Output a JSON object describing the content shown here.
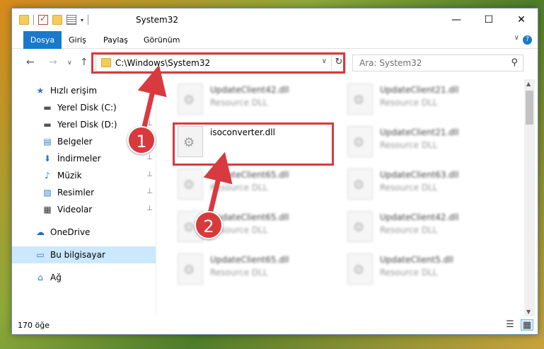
{
  "window": {
    "title": "System32",
    "controls": {
      "minimize": "—",
      "maximize": "☐",
      "close": "✕"
    }
  },
  "ribbon": {
    "tabs": [
      {
        "label": "Dosya",
        "active": true
      },
      {
        "label": "Giriş"
      },
      {
        "label": "Paylaş"
      },
      {
        "label": "Görünüm"
      }
    ],
    "help": "?",
    "collapse": "∨"
  },
  "nav": {
    "back": "←",
    "forward": "→",
    "recent": "∨",
    "up": "↑",
    "address": "C:\\Windows\\System32",
    "address_dropdown": "∨",
    "refresh": "↻",
    "search_placeholder": "Ara: System32",
    "search_icon": "search-icon"
  },
  "sidebar": {
    "items": [
      {
        "label": "Hızlı erişim",
        "icon": "star-icon",
        "glyph": "★",
        "color": "#2b78c4"
      },
      {
        "label": "Yerel Disk (C:)",
        "icon": "drive-icon",
        "glyph": "▬",
        "color": "#555555",
        "pinned": true
      },
      {
        "label": "Yerel Disk (D:)",
        "icon": "drive-icon",
        "glyph": "▬",
        "color": "#555555",
        "pinned": true
      },
      {
        "label": "Belgeler",
        "icon": "document-icon",
        "glyph": "▤",
        "color": "#2b78c4",
        "pinned": true
      },
      {
        "label": "İndirmeler",
        "icon": "download-icon",
        "glyph": "⬇",
        "color": "#2b78c4",
        "pinned": true
      },
      {
        "label": "Müzik",
        "icon": "music-icon",
        "glyph": "♪",
        "color": "#2b78c4",
        "pinned": true
      },
      {
        "label": "Resimler",
        "icon": "pictures-icon",
        "glyph": "▨",
        "color": "#2b78c4",
        "pinned": true
      },
      {
        "label": "Videolar",
        "icon": "video-icon",
        "glyph": "▦",
        "color": "#333333",
        "pinned": true
      },
      {
        "label": "OneDrive",
        "icon": "cloud-icon",
        "glyph": "☁",
        "color": "#1a6fc8"
      },
      {
        "label": "Bu bilgisayar",
        "icon": "computer-icon",
        "glyph": "▭",
        "color": "#2b78c4",
        "selected": true
      },
      {
        "label": "Ağ",
        "icon": "network-icon",
        "glyph": "⌂",
        "color": "#2b78c4"
      }
    ],
    "pin_glyph": "📌"
  },
  "files": [
    {
      "name": "UpdateClient42.dll",
      "type": "Resource DLL",
      "blurred": true
    },
    {
      "name": "UpdateClient21.dll",
      "type": "Resource DLL",
      "blurred": true
    },
    {
      "name": "isoconverter.dll",
      "type": "",
      "blurred": false
    },
    {
      "name": "UpdateClient21.dll",
      "type": "Resource DLL",
      "blurred": true
    },
    {
      "name": "UpdateClient65.dll",
      "type": "Resource DLL",
      "blurred": true
    },
    {
      "name": "UpdateClient63.dll",
      "type": "Resource DLL",
      "blurred": true
    },
    {
      "name": "UpdateClient65.dll",
      "type": "Resource DLL",
      "blurred": true
    },
    {
      "name": "UpdateClient42.dll",
      "type": "Resource DLL",
      "blurred": true
    },
    {
      "name": "UpdateClient65.dll",
      "type": "Resource DLL",
      "blurred": true
    },
    {
      "name": "UpdateClient5.dll",
      "type": "Resource DLL",
      "blurred": true
    }
  ],
  "status": {
    "count": "170 öğe",
    "view_details": "☰",
    "view_icons": "▦"
  },
  "annotations": {
    "badge1": "1",
    "badge2": "2",
    "color": "#d83a3f"
  },
  "scrollbar": {
    "up": "▲",
    "down": "▼"
  }
}
